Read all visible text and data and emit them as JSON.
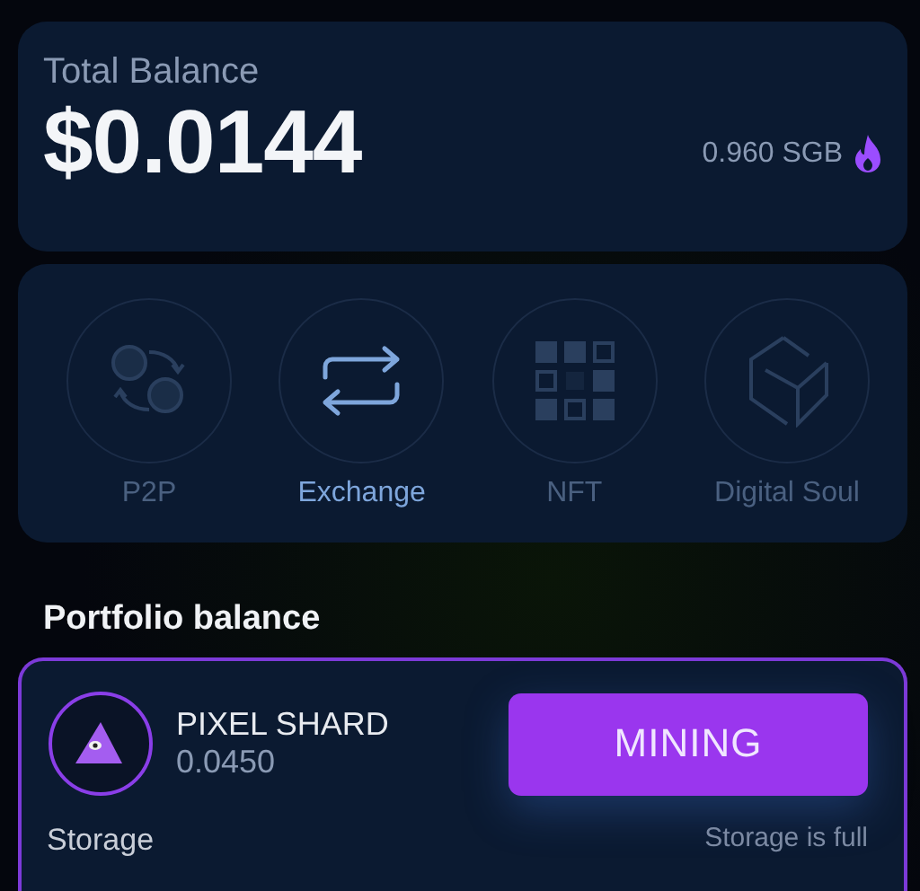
{
  "balance": {
    "label": "Total Balance",
    "amount": "$0.0144",
    "token_amount": "0.960 SGB"
  },
  "actions": [
    {
      "kind": "p2p",
      "label": "P2P",
      "disabled": true
    },
    {
      "kind": "exchange",
      "label": "Exchange",
      "disabled": false
    },
    {
      "kind": "nft",
      "label": "NFT",
      "disabled": true
    },
    {
      "kind": "soul",
      "label": "Digital Soul",
      "disabled": true
    }
  ],
  "portfolio": {
    "title": "Portfolio balance",
    "asset": {
      "name": "PIXEL SHARD",
      "amount": "0.0450"
    },
    "mining_button": "MINING",
    "storage_label": "Storage",
    "storage_status": "Storage is full"
  }
}
